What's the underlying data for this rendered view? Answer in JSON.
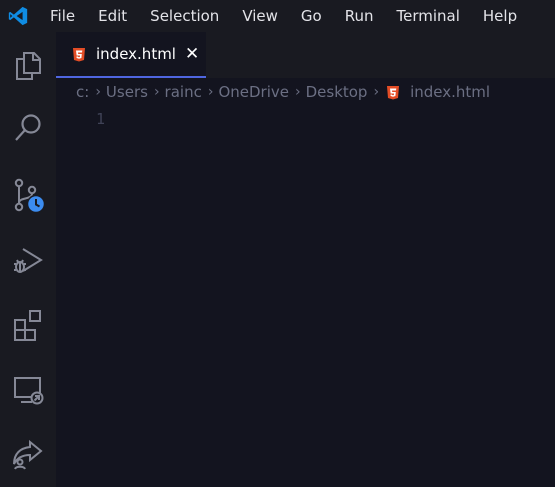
{
  "app": {
    "icon": "vscode-logo-icon",
    "accent": "#0078d4"
  },
  "menu": [
    "File",
    "Edit",
    "Selection",
    "View",
    "Go",
    "Run",
    "Terminal",
    "Help"
  ],
  "activity_bar": [
    {
      "icon": "explorer-files-icon"
    },
    {
      "icon": "search-icon"
    },
    {
      "icon": "source-control-icon",
      "badge_icon": "clock-icon",
      "badge_color": "#3c8cf0"
    },
    {
      "icon": "run-debug-icon"
    },
    {
      "icon": "extensions-icon"
    },
    {
      "icon": "remote-explorer-icon"
    },
    {
      "icon": "live-share-icon"
    }
  ],
  "tab": {
    "label": "index.html",
    "close": "✕",
    "icon": "html5-icon",
    "icon_color": "#e44d26"
  },
  "breadcrumb": [
    "c:",
    "Users",
    "rainc",
    "OneDrive",
    "Desktop",
    "index.html"
  ],
  "editor": {
    "line_numbers": [
      "1"
    ]
  }
}
